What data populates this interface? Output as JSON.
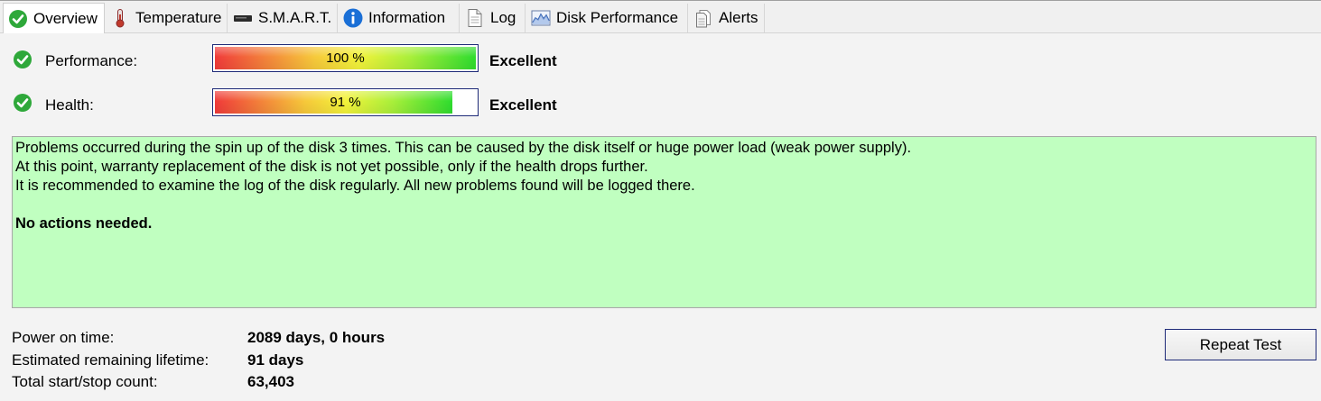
{
  "tabs": [
    {
      "label": "Overview",
      "icon": "check-circle-icon"
    },
    {
      "label": "Temperature",
      "icon": "thermometer-icon"
    },
    {
      "label": "S.M.A.R.T.",
      "icon": "drive-icon"
    },
    {
      "label": "Information",
      "icon": "info-icon"
    },
    {
      "label": "Log",
      "icon": "document-icon"
    },
    {
      "label": "Disk Performance",
      "icon": "performance-chart-icon"
    },
    {
      "label": "Alerts",
      "icon": "alerts-icon"
    }
  ],
  "active_tab": "Overview",
  "performance": {
    "label": "Performance:",
    "value": 100,
    "text": "100 %",
    "rating": "Excellent",
    "icon": "check-circle-icon"
  },
  "health": {
    "label": "Health:",
    "value": 91,
    "text": "91 %",
    "rating": "Excellent",
    "icon": "check-circle-icon"
  },
  "message": {
    "lines": [
      "Problems occurred during the spin up of the disk 3 times. This can be caused by the disk itself or huge power load (weak power supply).",
      "At this point, warranty replacement of the disk is not yet possible, only if the health drops further.",
      "It is recommended to examine the log of the disk regularly. All new problems found will be logged there."
    ],
    "conclusion": "No actions needed.",
    "background": "#c0ffc0"
  },
  "stats": [
    {
      "label": "Power on time:",
      "value": "2089 days, 0 hours"
    },
    {
      "label": "Estimated remaining lifetime:",
      "value": "91 days"
    },
    {
      "label": "Total start/stop count:",
      "value": "63,403"
    }
  ],
  "repeat_button": "Repeat Test",
  "colors": {
    "status_green": "#2ea83a",
    "info_blue": "#1a6fd6",
    "button_border": "#1e2a78"
  }
}
